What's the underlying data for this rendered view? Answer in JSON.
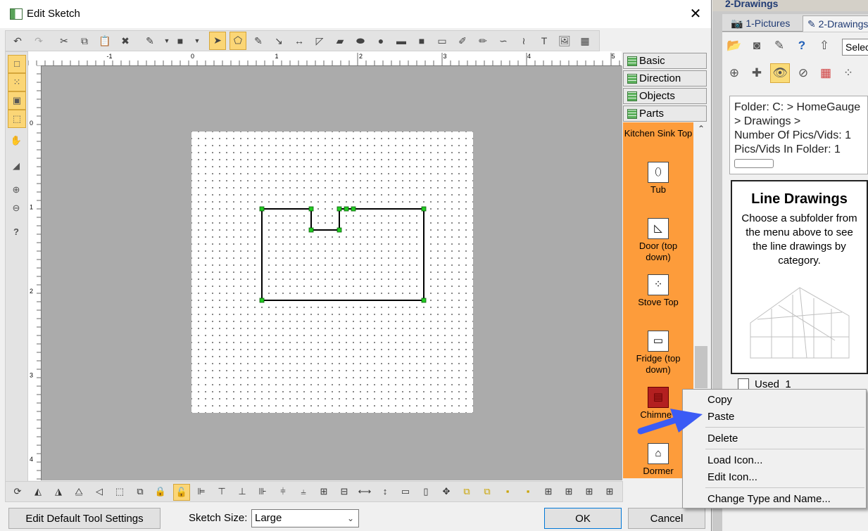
{
  "window": {
    "title": "Edit Sketch",
    "close_glyph": "✕"
  },
  "background_app": {
    "title": "2-Drawings",
    "tabs": [
      "1-Pictures",
      "2-Drawings"
    ],
    "select_value": "Select",
    "info_lines": [
      "Folder: C: > HomeGauge",
      "> Drawings >",
      "Number Of Pics/Vids: 1",
      "Pics/Vids In Folder: 1"
    ],
    "card": {
      "title": "Line Drawings",
      "text": "Choose a subfolder from the menu above to see the line drawings by category."
    },
    "used_label": "Used",
    "used_count": "1"
  },
  "ruler": {
    "h_labels": [
      "-1",
      "0",
      "1",
      "2",
      "3",
      "4",
      "5"
    ],
    "v_labels": [
      "0",
      "1",
      "2",
      "3",
      "4"
    ]
  },
  "right_tabs": [
    "Basic",
    "Direction",
    "Objects",
    "Parts"
  ],
  "parts": [
    {
      "label": "Kitchen Sink Top",
      "icon": "sink-icon"
    },
    {
      "label": "Tub",
      "icon": "tub-icon"
    },
    {
      "label": "Door (top down)",
      "icon": "door-icon"
    },
    {
      "label": "Stove Top",
      "icon": "stove-icon"
    },
    {
      "label": "Fridge (top down)",
      "icon": "fridge-icon"
    },
    {
      "label": "Chimney",
      "icon": "chimney-icon"
    },
    {
      "label": "Dormer",
      "icon": "dormer-icon"
    }
  ],
  "footer": {
    "edit_defaults": "Edit Default Tool Settings",
    "sketch_size_label": "Sketch Size:",
    "sketch_size_value": "Large",
    "ok": "OK",
    "cancel": "Cancel"
  },
  "context_menu": [
    "Copy",
    "Paste",
    "Delete",
    "Load Icon...",
    "Edit Icon...",
    "Change Type and Name..."
  ],
  "colors": {
    "accent_orange": "#fd9c3b",
    "highlight": "#fbd676",
    "arrow_blue": "#3b5bf5",
    "handle_green": "#22cc22"
  }
}
